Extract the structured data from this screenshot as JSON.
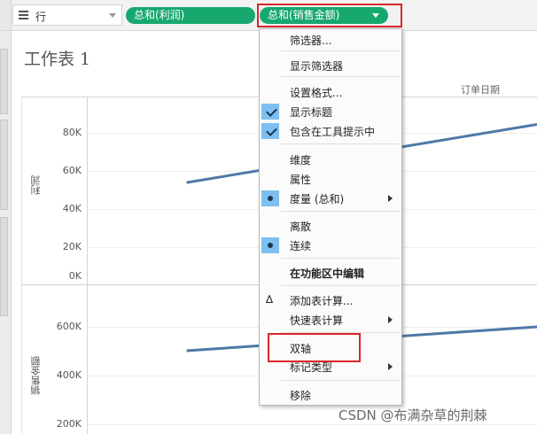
{
  "shelf": {
    "rows_label": "行",
    "pills": [
      {
        "label": "总和(利润)"
      },
      {
        "label": "总和(销售金额)"
      }
    ]
  },
  "worksheet": {
    "title": "工作表 1",
    "column_header": "订单日期"
  },
  "chart_data": [
    {
      "type": "line",
      "ylabel": "利润",
      "y_ticks": [
        "80K",
        "60K",
        "40K",
        "20K",
        "0K"
      ],
      "ylim": [
        0,
        90000
      ],
      "series": [
        {
          "x": [
            0.22,
            1.0
          ],
          "values": [
            49000,
            77000
          ]
        }
      ],
      "color": "#4e79a7"
    },
    {
      "type": "line",
      "ylabel": "销售金额",
      "y_ticks": [
        "600K",
        "400K",
        "200K"
      ],
      "ylim": [
        150000,
        740000
      ],
      "series": [
        {
          "x": [
            0.22,
            1.0
          ],
          "values": [
            480000,
            575000
          ]
        }
      ],
      "color": "#4e79a7"
    }
  ],
  "menu": {
    "items": [
      {
        "label": "筛选器..."
      },
      {
        "label": "显示筛选器"
      },
      {
        "label": "设置格式..."
      },
      {
        "label": "显示标题",
        "checked": true
      },
      {
        "label": "包含在工具提示中",
        "checked": true
      },
      {
        "label": "维度"
      },
      {
        "label": "属性"
      },
      {
        "label": "度量 (总和)",
        "selected": true,
        "submenu": true
      },
      {
        "label": "离散"
      },
      {
        "label": "连续",
        "selected": true
      },
      {
        "label": "在功能区中编辑",
        "bold": true
      },
      {
        "label": "添加表计算...",
        "icon": "delta"
      },
      {
        "label": "快速表计算",
        "submenu": true
      },
      {
        "label": "双轴"
      },
      {
        "label": "标记类型",
        "submenu": true
      },
      {
        "label": "移除"
      }
    ]
  },
  "icons": {
    "delta": "∆"
  },
  "colors": {
    "pill": "#17a86f",
    "highlight": "#d9262c",
    "line": "#4e79a7",
    "menu_selected": "#7dbff0"
  },
  "watermark": "CSDN @布满杂草的荆棘"
}
